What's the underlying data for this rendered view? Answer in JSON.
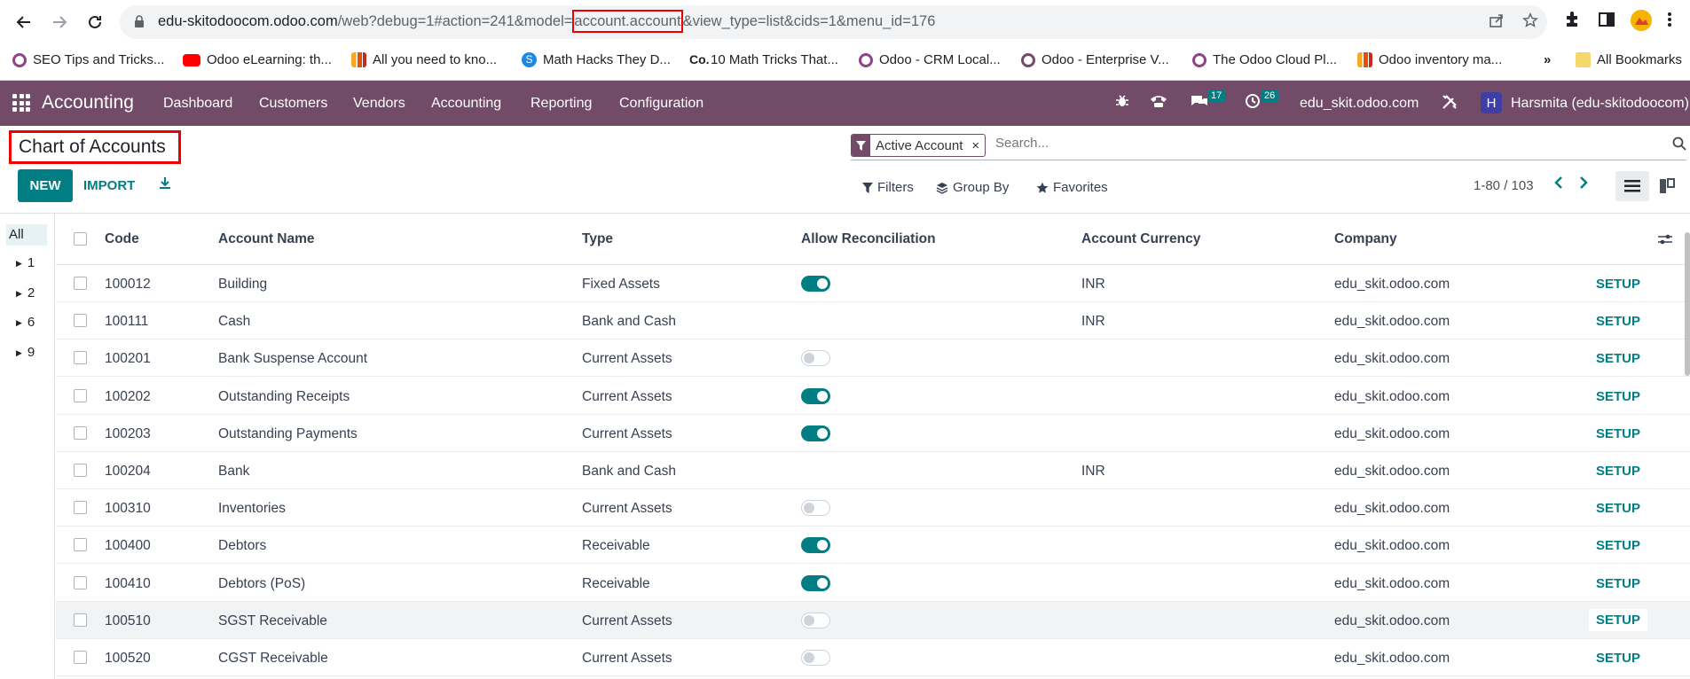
{
  "browser": {
    "url_prefix": "edu-skitodoocom.odoo.com",
    "url_path": "/web?debug=1#action=241&model=",
    "url_highlight": "account.account",
    "url_suffix": "&view_type=list&cids=1&menu_id=176",
    "bookmarks": [
      {
        "label": "SEO Tips and Tricks...",
        "color": "#ffffff"
      },
      {
        "label": "Odoo eLearning: th...",
        "color": "#ff0000"
      },
      {
        "label": "All you need to kno...",
        "color": "#f9a825"
      },
      {
        "label": "Math Hacks They D...",
        "color": "#1e88e5"
      },
      {
        "label": "10 Math Tricks That...",
        "color": "#222222"
      },
      {
        "label": "Odoo - CRM Local...",
        "color": "#8e4585"
      },
      {
        "label": "Odoo - Enterprise V...",
        "color": "#714b67"
      },
      {
        "label": "The Odoo Cloud Pl...",
        "color": "#8e4585"
      },
      {
        "label": "Odoo inventory ma...",
        "color": "#f9a825"
      }
    ],
    "more_bookmarks": "»",
    "all_bookmarks": "All Bookmarks"
  },
  "navbar": {
    "brand": "Accounting",
    "menu": [
      "Dashboard",
      "Customers",
      "Vendors",
      "Accounting",
      "Reporting",
      "Configuration"
    ],
    "messages_count": "17",
    "activities_count": "26",
    "company": "edu_skit.odoo.com",
    "avatar_letter": "H",
    "user": "Harsmita (edu-skitodoocom)"
  },
  "control_panel": {
    "title": "Chart of Accounts",
    "new_label": "NEW",
    "import_label": "IMPORT",
    "facet_label": "Active Account",
    "facet_remove": "×",
    "search_placeholder": "Search...",
    "filters_label": "Filters",
    "groupby_label": "Group By",
    "favorites_label": "Favorites",
    "pager": "1-80 / 103"
  },
  "sidebar": {
    "all_label": "All",
    "groups": [
      "1",
      "2",
      "6",
      "9"
    ]
  },
  "table": {
    "headers": {
      "code": "Code",
      "name": "Account Name",
      "type": "Type",
      "reconcile": "Allow Reconciliation",
      "currency": "Account Currency",
      "company": "Company"
    },
    "setup_label": "SETUP",
    "rows": [
      {
        "code": "100012",
        "name": "Building",
        "type": "Fixed Assets",
        "reconcile": "on",
        "currency": "INR",
        "company": "edu_skit.odoo.com"
      },
      {
        "code": "100111",
        "name": "Cash",
        "type": "Bank and Cash",
        "reconcile": "none",
        "currency": "INR",
        "company": "edu_skit.odoo.com"
      },
      {
        "code": "100201",
        "name": "Bank Suspense Account",
        "type": "Current Assets",
        "reconcile": "off",
        "currency": "",
        "company": "edu_skit.odoo.com"
      },
      {
        "code": "100202",
        "name": "Outstanding Receipts",
        "type": "Current Assets",
        "reconcile": "on",
        "currency": "",
        "company": "edu_skit.odoo.com"
      },
      {
        "code": "100203",
        "name": "Outstanding Payments",
        "type": "Current Assets",
        "reconcile": "on",
        "currency": "",
        "company": "edu_skit.odoo.com"
      },
      {
        "code": "100204",
        "name": "Bank",
        "type": "Bank and Cash",
        "reconcile": "none",
        "currency": "INR",
        "company": "edu_skit.odoo.com"
      },
      {
        "code": "100310",
        "name": "Inventories",
        "type": "Current Assets",
        "reconcile": "off",
        "currency": "",
        "company": "edu_skit.odoo.com"
      },
      {
        "code": "100400",
        "name": "Debtors",
        "type": "Receivable",
        "reconcile": "on",
        "currency": "",
        "company": "edu_skit.odoo.com"
      },
      {
        "code": "100410",
        "name": "Debtors (PoS)",
        "type": "Receivable",
        "reconcile": "on",
        "currency": "",
        "company": "edu_skit.odoo.com"
      },
      {
        "code": "100510",
        "name": "SGST Receivable",
        "type": "Current Assets",
        "reconcile": "off",
        "currency": "",
        "company": "edu_skit.odoo.com"
      },
      {
        "code": "100520",
        "name": "CGST Receivable",
        "type": "Current Assets",
        "reconcile": "off",
        "currency": "",
        "company": "edu_skit.odoo.com"
      }
    ]
  },
  "colors": {
    "navbar": "#714b67",
    "accent": "#017e84",
    "highlight_box": "#ee0000"
  }
}
